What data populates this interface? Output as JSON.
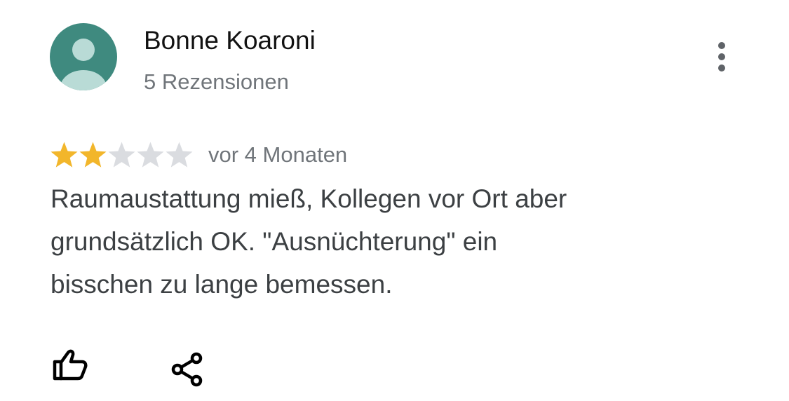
{
  "review": {
    "author": {
      "name": "Bonne Koaroni",
      "review_count": "5 Rezensionen",
      "avatar_icon": "default-person-avatar-icon",
      "avatar_color": "#3f8a7f"
    },
    "rating": {
      "value": 2,
      "max": 5,
      "filled_color": "#f2b62b",
      "empty_color": "#dadce0"
    },
    "date": "vor 4 Monaten",
    "text_lines": [
      "Raumaustattung mieß, Kollegen vor Ort aber",
      "grundsätzlich OK. \"Ausnüchterung\" ein",
      "bisschen zu lange bemessen."
    ],
    "actions": {
      "more_icon": "more-vertical-icon",
      "like_icon": "thumbs-up-icon",
      "share_icon": "share-icon"
    }
  }
}
